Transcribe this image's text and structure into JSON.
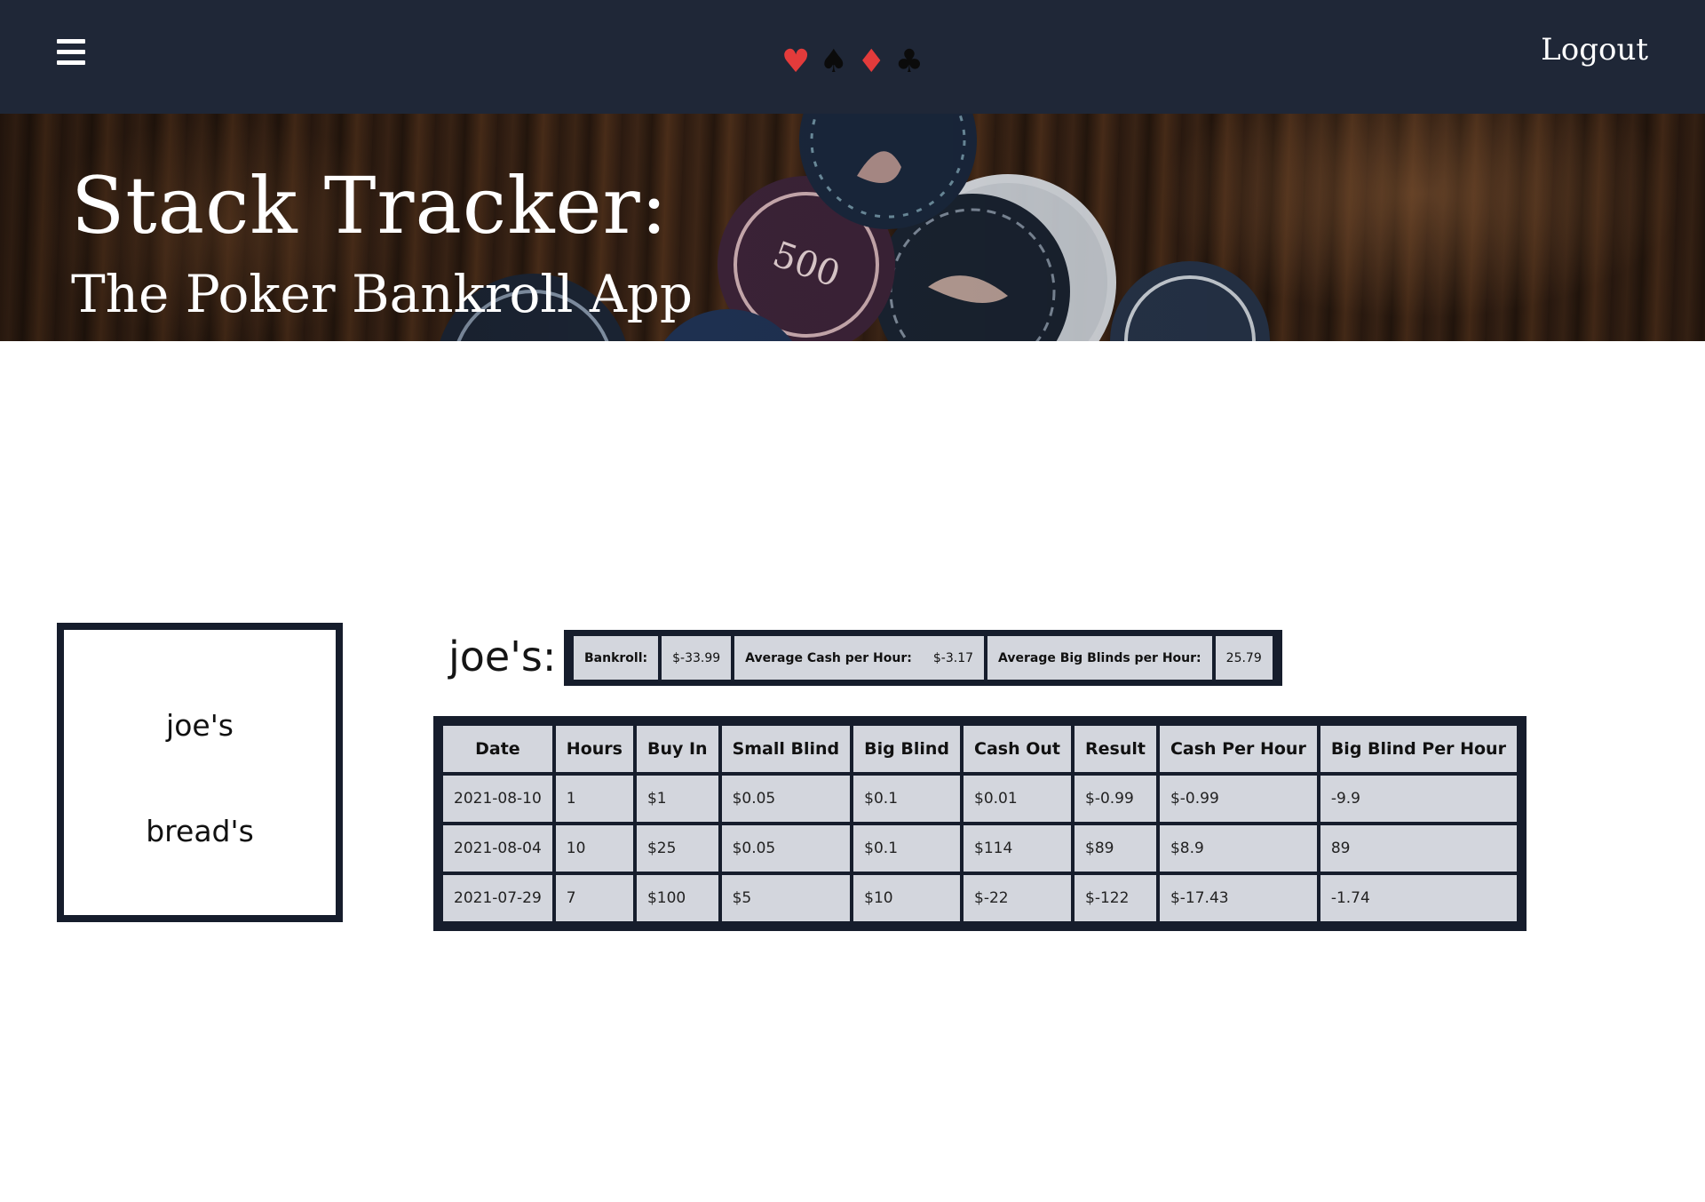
{
  "nav": {
    "menu_icon": "hamburger-icon",
    "suits": [
      {
        "glyph": "♥",
        "icon": "heart-icon",
        "color": "#e33b3b"
      },
      {
        "glyph": "♠",
        "icon": "spade-icon",
        "color": "#0b0b0b"
      },
      {
        "glyph": "♦",
        "icon": "diamond-icon",
        "color": "#e33b3b"
      },
      {
        "glyph": "♣",
        "icon": "club-icon",
        "color": "#0b0b0b"
      }
    ],
    "logout_label": "Logout"
  },
  "hero": {
    "title": "Stack Tracker:",
    "subtitle": "The Poker Bankroll App"
  },
  "sidebar": {
    "items": [
      {
        "label": "joe's"
      },
      {
        "label": "bread's"
      }
    ]
  },
  "stats": {
    "title": "joe's:",
    "bankroll_label": "Bankroll:",
    "bankroll_value": "$-33.99",
    "avg_cash_label": "Average Cash per Hour:",
    "avg_cash_value": "$-3.17",
    "avg_bb_label": "Average Big Blinds per Hour:",
    "avg_bb_value": "25.79"
  },
  "sessions": {
    "headers": [
      "Date",
      "Hours",
      "Buy In",
      "Small Blind",
      "Big Blind",
      "Cash Out",
      "Result",
      "Cash Per Hour",
      "Big Blind Per Hour"
    ],
    "rows": [
      [
        "2021-08-10",
        "1",
        "$1",
        "$0.05",
        "$0.1",
        "$0.01",
        "$-0.99",
        "$-0.99",
        "-9.9"
      ],
      [
        "2021-08-04",
        "10",
        "$25",
        "$0.05",
        "$0.1",
        "$114",
        "$89",
        "$8.9",
        "89"
      ],
      [
        "2021-07-29",
        "7",
        "$100",
        "$5",
        "$10",
        "$-22",
        "$-122",
        "$-17.43",
        "-1.74"
      ]
    ]
  },
  "colors": {
    "navbar": "#1f2737",
    "table_border": "#161d2c",
    "cell_bg": "#d3d6dd",
    "suit_red": "#e33b3b"
  }
}
